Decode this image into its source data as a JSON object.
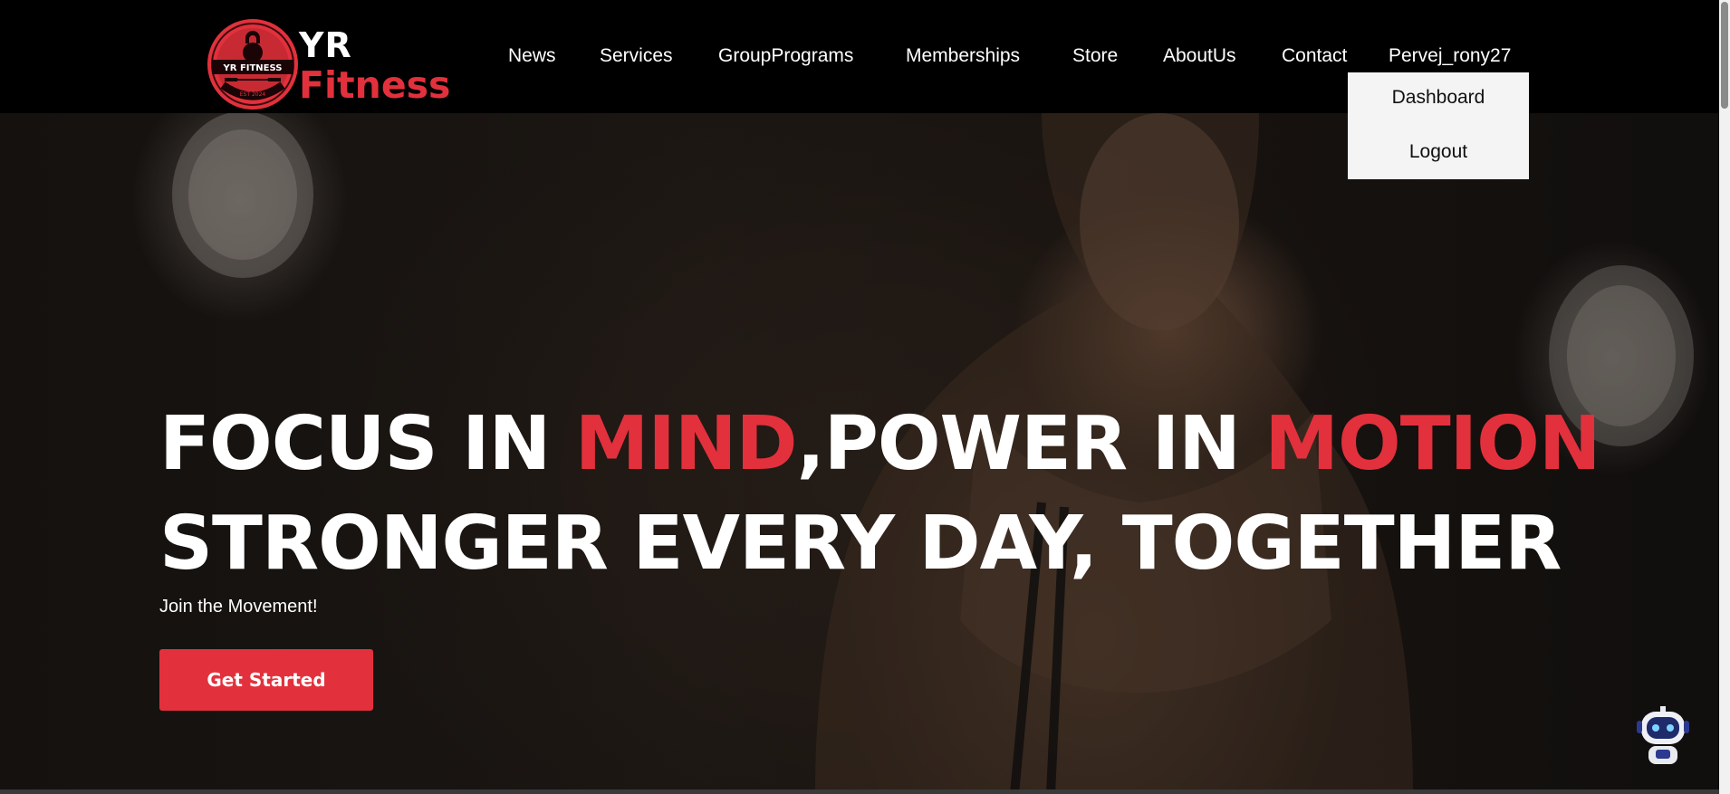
{
  "brand": {
    "badge_text": "YR FITNESS",
    "badge_est": "EST 2024",
    "name_top": "YR",
    "name_bottom": "Fitness",
    "accent_color": "#e2313c"
  },
  "nav": {
    "items": [
      {
        "label": "News"
      },
      {
        "label": "Services"
      },
      {
        "label": "GroupPrograms"
      },
      {
        "label": "Memberships"
      },
      {
        "label": "Store"
      },
      {
        "label": "AboutUs"
      },
      {
        "label": "Contact"
      }
    ],
    "user": "Pervej_rony27"
  },
  "user_menu": {
    "items": [
      {
        "label": "Dashboard"
      },
      {
        "label": "Logout"
      }
    ]
  },
  "hero": {
    "line1": {
      "part1": "FOCUS IN ",
      "accent1": "MIND",
      "part2": ",POWER IN ",
      "accent2": "MOTION"
    },
    "line2": "STRONGER EVERY DAY, TOGETHER",
    "tagline": "Join the Movement!",
    "cta_label": "Get Started"
  },
  "chatbot": {
    "icon": "robot-icon"
  }
}
